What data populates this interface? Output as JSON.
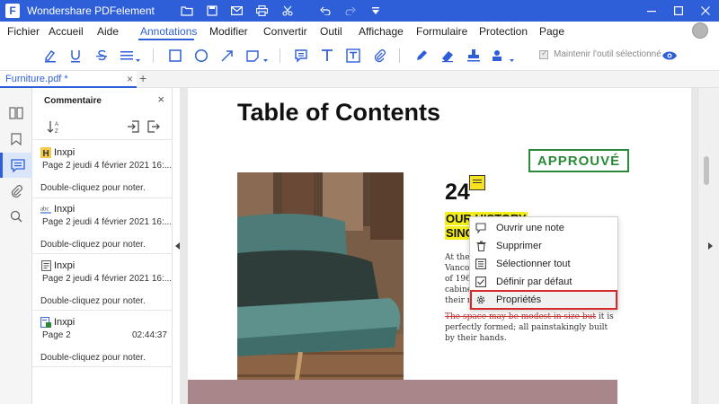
{
  "app": {
    "title": "Wondershare PDFelement",
    "logo_glyph": "F",
    "accent": "#2e5fd8"
  },
  "menu": {
    "items": [
      {
        "label": "Fichier"
      },
      {
        "label": "Accueil"
      },
      {
        "label": "Aide"
      },
      {
        "label": "Annotations",
        "active": true
      },
      {
        "label": "Modifier"
      },
      {
        "label": "Convertir"
      },
      {
        "label": "Outil"
      },
      {
        "label": "Affichage"
      },
      {
        "label": "Formulaire"
      },
      {
        "label": "Protection"
      },
      {
        "label": "Page"
      }
    ]
  },
  "toolbar": {
    "keep_tool_label": "Maintenir l'outil sélectionné",
    "keep_tool_checked": true
  },
  "tabs": {
    "active_label": "Furniture.pdf *",
    "close_glyph": "×",
    "new_tab_glyph": "+"
  },
  "panel": {
    "title": "Commentaire",
    "close_glyph": "×",
    "comments": [
      {
        "icon": "highlight-icon",
        "author": "Inxpi",
        "page": "Page 2",
        "date": "jeudi 4 février 2021 16:...",
        "note": "Double-cliquez pour noter."
      },
      {
        "icon": "underline-text-icon",
        "author": "Inxpi",
        "page": "Page 2",
        "date": "jeudi 4 février 2021 16:...",
        "note": "Double-cliquez pour noter."
      },
      {
        "icon": "note-icon",
        "author": "Inxpi",
        "page": "Page 2",
        "date": "jeudi 4 février 2021 16:...",
        "note": "Double-cliquez pour noter."
      },
      {
        "icon": "stamp-icon",
        "author": "Inxpi",
        "page": "Page 2",
        "date": "02:44:37",
        "note": "Double-cliquez pour noter."
      }
    ]
  },
  "document": {
    "heading": "Table of Contents",
    "stamp_text": "APPROUVÉ",
    "number": "24",
    "highlight_line1": "OUR HISTORY",
    "highlight_line2": "SINCE",
    "body_lines": [
      "At the b",
      "Vancou",
      "of 1965,",
      "cabinet",
      "their ne"
    ],
    "strike_line": "The space may be modest in size but",
    "strike_tail": " it is",
    "body_after": [
      "perfectly formed; all painstakingly built",
      "by their hands."
    ]
  },
  "context_menu": {
    "items": [
      {
        "label": "Ouvrir une note",
        "icon": "note-open-icon"
      },
      {
        "label": "Supprimer",
        "icon": "trash-icon"
      },
      {
        "label": "Sélectionner tout",
        "icon": "select-all-icon"
      },
      {
        "label": "Définir par défaut",
        "icon": "checkbox-icon"
      },
      {
        "label": "Propriétés",
        "icon": "gear-icon",
        "highlighted": true
      }
    ]
  }
}
